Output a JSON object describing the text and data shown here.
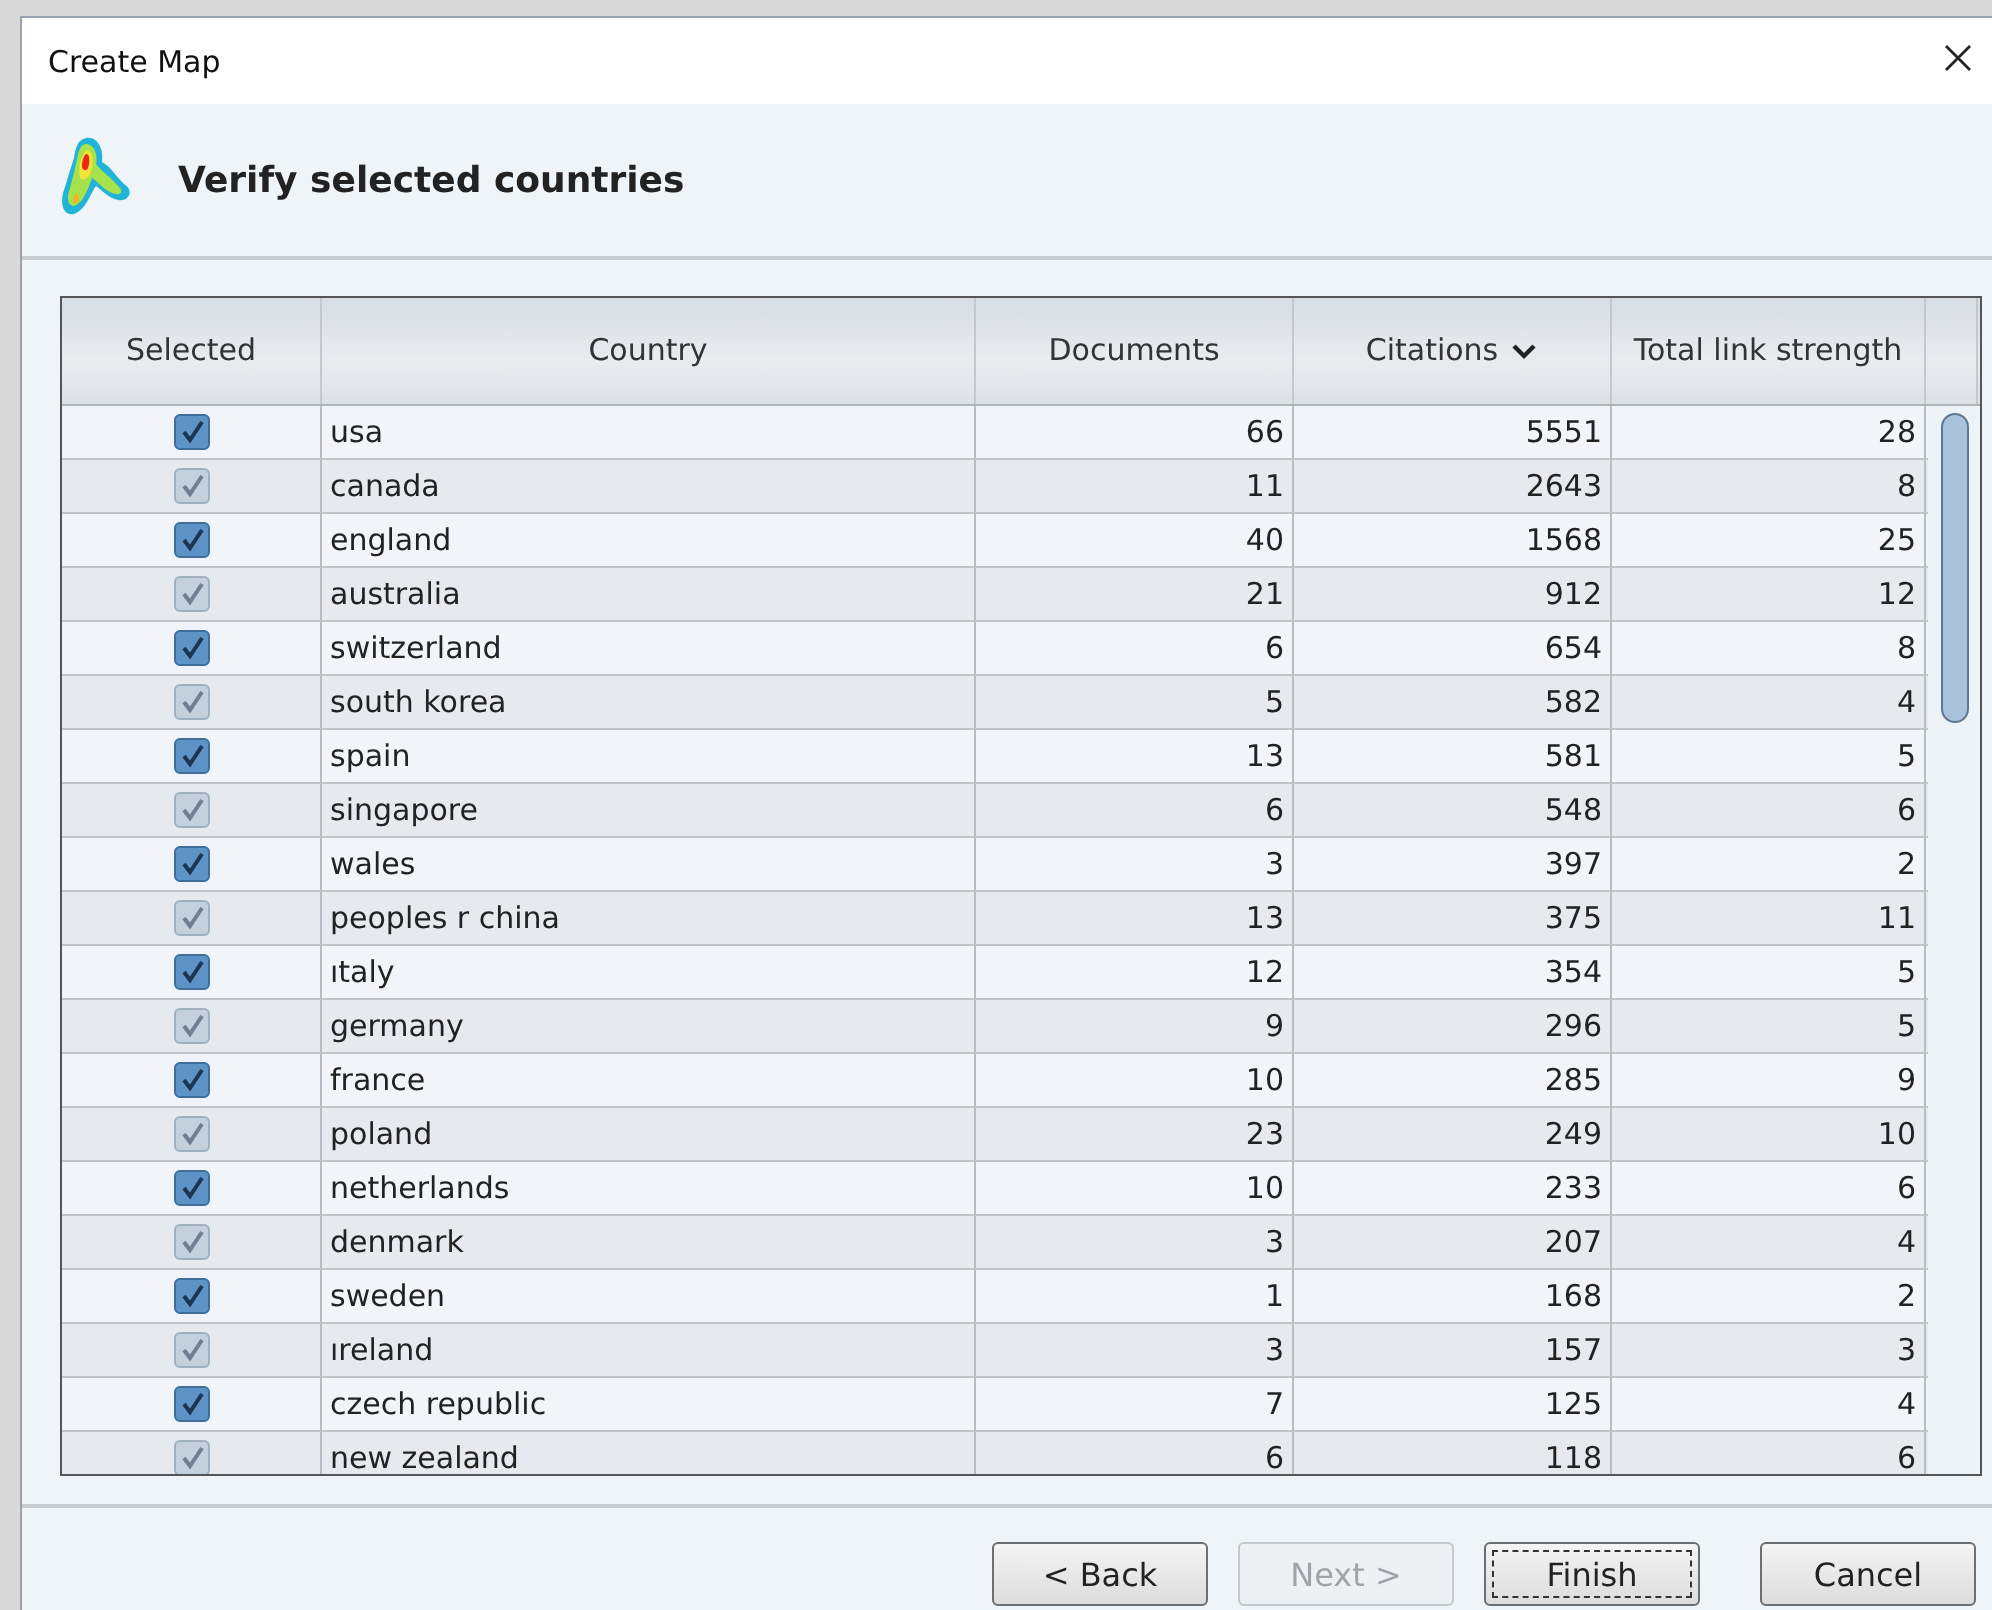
{
  "window": {
    "title": "Create Map"
  },
  "header": {
    "title": "Verify selected countries"
  },
  "table": {
    "columns": [
      {
        "label": "Selected",
        "sorted": false
      },
      {
        "label": "Country",
        "sorted": false
      },
      {
        "label": "Documents",
        "sorted": false
      },
      {
        "label": "Citations",
        "sorted": true
      },
      {
        "label": "Total link strength",
        "sorted": false
      }
    ],
    "rows": [
      {
        "checked": true,
        "country": "usa",
        "documents": "66",
        "citations": "5551",
        "strength": "28"
      },
      {
        "checked": true,
        "country": "canada",
        "documents": "11",
        "citations": "2643",
        "strength": "8"
      },
      {
        "checked": true,
        "country": "england",
        "documents": "40",
        "citations": "1568",
        "strength": "25"
      },
      {
        "checked": true,
        "country": "australia",
        "documents": "21",
        "citations": "912",
        "strength": "12"
      },
      {
        "checked": true,
        "country": "switzerland",
        "documents": "6",
        "citations": "654",
        "strength": "8"
      },
      {
        "checked": true,
        "country": "south korea",
        "documents": "5",
        "citations": "582",
        "strength": "4"
      },
      {
        "checked": true,
        "country": "spain",
        "documents": "13",
        "citations": "581",
        "strength": "5"
      },
      {
        "checked": true,
        "country": "singapore",
        "documents": "6",
        "citations": "548",
        "strength": "6"
      },
      {
        "checked": true,
        "country": "wales",
        "documents": "3",
        "citations": "397",
        "strength": "2"
      },
      {
        "checked": true,
        "country": "peoples r china",
        "documents": "13",
        "citations": "375",
        "strength": "11"
      },
      {
        "checked": true,
        "country": "ıtaly",
        "documents": "12",
        "citations": "354",
        "strength": "5"
      },
      {
        "checked": true,
        "country": "germany",
        "documents": "9",
        "citations": "296",
        "strength": "5"
      },
      {
        "checked": true,
        "country": "france",
        "documents": "10",
        "citations": "285",
        "strength": "9"
      },
      {
        "checked": true,
        "country": "poland",
        "documents": "23",
        "citations": "249",
        "strength": "10"
      },
      {
        "checked": true,
        "country": "netherlands",
        "documents": "10",
        "citations": "233",
        "strength": "6"
      },
      {
        "checked": true,
        "country": "denmark",
        "documents": "3",
        "citations": "207",
        "strength": "4"
      },
      {
        "checked": true,
        "country": "sweden",
        "documents": "1",
        "citations": "168",
        "strength": "2"
      },
      {
        "checked": true,
        "country": "ıreland",
        "documents": "3",
        "citations": "157",
        "strength": "3"
      },
      {
        "checked": true,
        "country": "czech republic",
        "documents": "7",
        "citations": "125",
        "strength": "4"
      },
      {
        "checked": true,
        "country": "new zealand",
        "documents": "6",
        "citations": "118",
        "strength": "6"
      }
    ]
  },
  "buttons": [
    {
      "label": "< Back",
      "disabled": false,
      "focused": false
    },
    {
      "label": "Next >",
      "disabled": true,
      "focused": false
    },
    {
      "label": "Finish",
      "disabled": false,
      "focused": true
    },
    {
      "label": "Cancel",
      "disabled": false,
      "focused": false
    }
  ]
}
